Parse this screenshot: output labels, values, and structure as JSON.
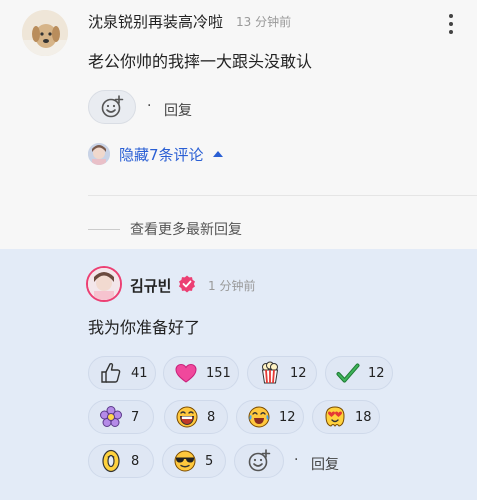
{
  "top_comment": {
    "username": "沈泉锐别再装高冷啦",
    "time": "13 分钟前",
    "text": "老公你帅的我摔一大跟头没敢认",
    "dot": "·",
    "reply_label": "回复",
    "hidden_replies_label": "隐藏7条评论"
  },
  "more_replies_label": "查看更多最新回复",
  "reply": {
    "username": "김규빈",
    "time": "1 分钟前",
    "text": "我为你准备好了",
    "dot": "·",
    "reply_label": "回复",
    "reactions": [
      {
        "icon": "thumbs-up-icon",
        "count": "41"
      },
      {
        "icon": "heart-icon",
        "count": "151"
      },
      {
        "icon": "popcorn-icon",
        "count": "12"
      },
      {
        "icon": "check-mark-icon",
        "count": "12"
      },
      {
        "icon": "flower-icon",
        "count": "7"
      },
      {
        "icon": "grinning-face-icon",
        "count": "8"
      },
      {
        "icon": "crying-laughing-icon",
        "count": "12"
      },
      {
        "icon": "heart-eyes-icon",
        "count": "18"
      },
      {
        "icon": "number-zero-icon",
        "count": "8"
      },
      {
        "icon": "sunglasses-face-icon",
        "count": "5"
      }
    ]
  },
  "colors": {
    "accent_blue": "#2a5fd4",
    "verified_pink": "#ec3f73",
    "reply_background": "#e3ebf7"
  }
}
